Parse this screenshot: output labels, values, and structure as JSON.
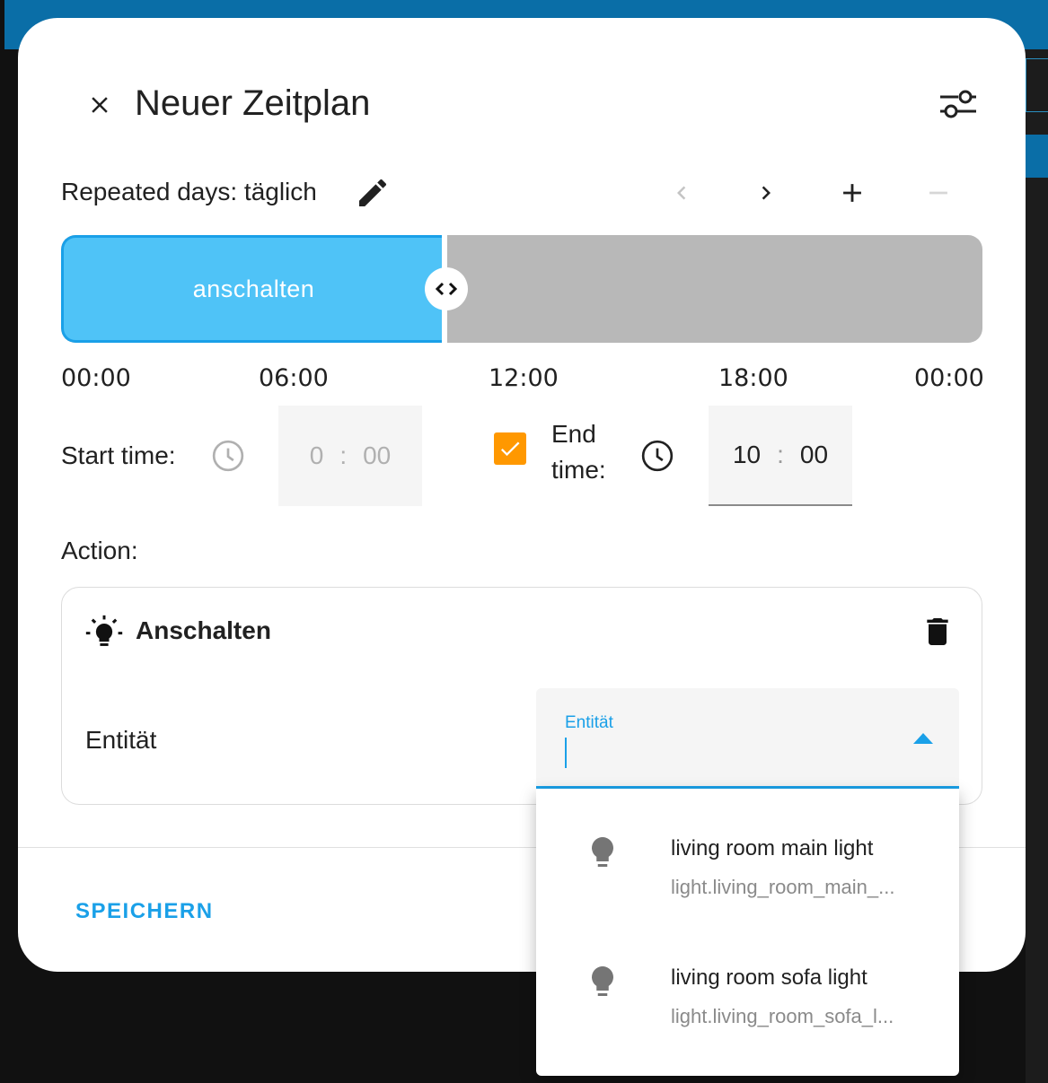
{
  "dialog": {
    "title": "Neuer Zeitplan",
    "close_icon": "close-icon",
    "filter_icon": "tune-icon"
  },
  "repeat": {
    "label": "Repeated days: täglich",
    "edit_icon": "pencil-icon"
  },
  "nav": {
    "prev_icon": "chevron-left-icon",
    "next_icon": "chevron-right-icon",
    "add_icon": "plus-icon",
    "remove_icon": "minus-icon"
  },
  "timeline": {
    "slot_on_label": "anschalten",
    "slot_on_color": "#4fc3f7",
    "slot_off_color": "#b8b8b8",
    "ticks": [
      "00:00",
      "06:00",
      "12:00",
      "18:00",
      "00:00"
    ]
  },
  "time": {
    "start_label": "Start time:",
    "start_hours": "0",
    "start_minutes": "00",
    "end_label": "End time:",
    "end_hours": "10",
    "end_minutes": "00",
    "separator": ":",
    "end_checked": true,
    "checkbox_color": "#ff9800"
  },
  "action": {
    "label": "Action:",
    "card_title": "Anschalten",
    "card_icon": "lightbulb-on-icon",
    "delete_icon": "trash-icon",
    "entity_label": "Entität",
    "entity_input_label": "Entität",
    "entity_input_value": ""
  },
  "footer": {
    "save_label": "SPEICHERN",
    "accent_color": "#1aa0e8"
  },
  "dropdown": {
    "options": [
      {
        "name": "living room main light",
        "entity_id": "light.living_room_main_...",
        "icon": "lightbulb-icon"
      },
      {
        "name": "living room sofa light",
        "entity_id": "light.living_room_sofa_l...",
        "icon": "lightbulb-icon"
      }
    ]
  }
}
